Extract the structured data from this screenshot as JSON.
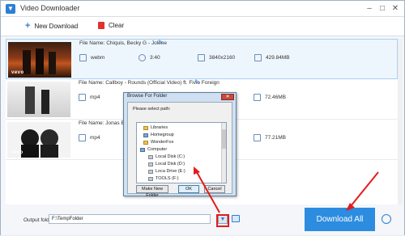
{
  "window": {
    "title": "Video Downloader",
    "controls": [
      "–",
      "□",
      "✕"
    ]
  },
  "toolbar": {
    "new_download": "New Download",
    "clear": "Clear"
  },
  "downloads": [
    {
      "file_name": "File Name: Chiquis, Becky G - Jolene",
      "format": "webm",
      "duration": "3:40",
      "resolution": "3840x2160",
      "size": "429.84MB",
      "thumb_label": "vevo"
    },
    {
      "file_name": "File Name: Callboy - Rounds (Official Video) ft. Fivio Foreign",
      "format": "mp4",
      "duration": "",
      "resolution": "",
      "size": "72.46MB",
      "thumb_label": ""
    },
    {
      "file_name": "File Name: Jonas Blue, R...",
      "format": "mp4",
      "duration": "",
      "resolution": "",
      "size": "77.21MB",
      "thumb_label": "vevo"
    }
  ],
  "dialog": {
    "title": "Browse For Folder",
    "subtitle": "Please select path:",
    "tree": [
      "Libraries",
      "Homegroup",
      "WonderFox",
      "Computer",
      "Local Disk (C:)",
      "Local Disk (D:)",
      "Loca Drive (E:)",
      "TOOLS (F:)"
    ],
    "make_new_folder": "Make New Folder",
    "ok": "OK",
    "cancel": "Cancel",
    "close": "✕"
  },
  "footer": {
    "output_label": "Output folder:",
    "output_value": "F:\\TempFolder",
    "download_all": "Download All"
  },
  "colors": {
    "accent": "#2c8ce0",
    "highlight": "#e21c1c"
  }
}
